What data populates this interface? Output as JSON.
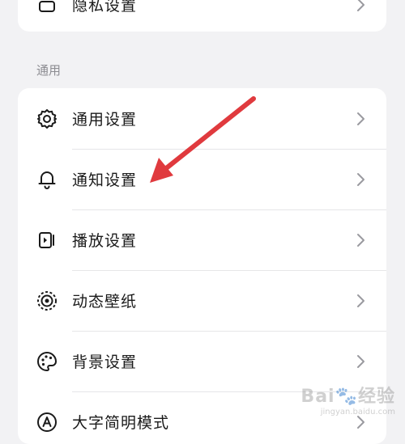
{
  "top_card": {
    "item_label": "隐私设置",
    "icon": "lock-icon"
  },
  "section": {
    "title": "通用"
  },
  "items": [
    {
      "label": "通用设置",
      "icon": "gear-icon"
    },
    {
      "label": "通知设置",
      "icon": "bell-icon"
    },
    {
      "label": "播放设置",
      "icon": "play-settings-icon"
    },
    {
      "label": "动态壁纸",
      "icon": "live-wallpaper-icon"
    },
    {
      "label": "背景设置",
      "icon": "palette-icon"
    },
    {
      "label": "大字简明模式",
      "icon": "large-font-icon"
    }
  ],
  "annotation": {
    "arrow_color": "#e03a3e"
  },
  "watermark": {
    "text": "Bai",
    "suffix": "经验",
    "url": "jingyan.baidu.com"
  }
}
